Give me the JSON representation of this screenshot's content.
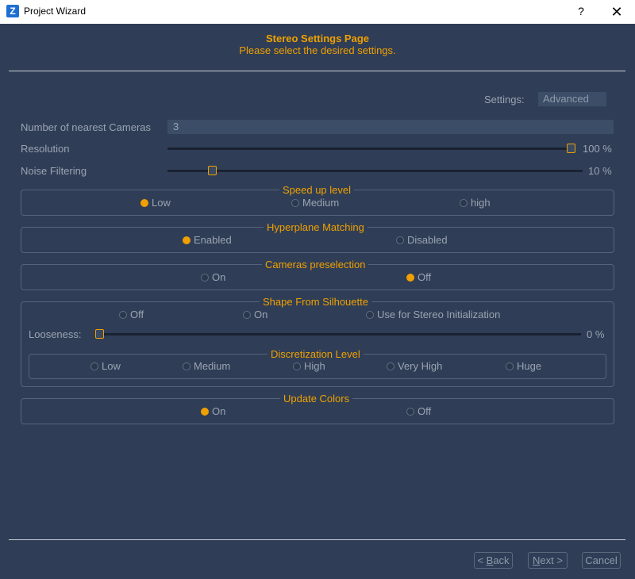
{
  "window": {
    "title": "Project Wizard",
    "help": "?",
    "close": "✕",
    "icon_letter": "Z"
  },
  "page": {
    "title": "Stereo Settings Page",
    "subtitle": "Please select the desired settings."
  },
  "settings": {
    "label": "Settings:",
    "value": "Advanced"
  },
  "cameras": {
    "label": "Number of nearest Cameras",
    "value": "3"
  },
  "resolution": {
    "label": "Resolution",
    "value_text": "100 %",
    "level_percent": 100
  },
  "noise": {
    "label": "Noise Filtering",
    "value_text": "10 %",
    "level_percent": 10
  },
  "speed": {
    "title": "Speed up level",
    "options": [
      "Low",
      "Medium",
      "high"
    ],
    "selected": "Low"
  },
  "hyperplane": {
    "title": "Hyperplane Matching",
    "options": [
      "Enabled",
      "Disabled"
    ],
    "selected": "Enabled"
  },
  "preselection": {
    "title": "Cameras preselection",
    "options": [
      "On",
      "Off"
    ],
    "selected": "Off"
  },
  "silhouette": {
    "title": "Shape From Silhouette",
    "options": [
      "Off",
      "On",
      "Use for Stereo Initialization"
    ],
    "selected": null,
    "looseness_label": "Looseness:",
    "looseness_text": "0 %",
    "looseness_percent": 0,
    "discretization": {
      "title": "Discretization Level",
      "options": [
        "Low",
        "Medium",
        "High",
        "Very High",
        "Huge"
      ],
      "selected": null
    }
  },
  "update_colors": {
    "title": "Update Colors",
    "options": [
      "On",
      "Off"
    ],
    "selected": "On"
  },
  "buttons": {
    "back": {
      "prefix": "< ",
      "accel": "B",
      "rest": "ack"
    },
    "next": {
      "accel": "N",
      "rest": "ext >"
    },
    "cancel": "Cancel"
  },
  "colors": {
    "accent": "#f0a000",
    "background": "#2f3e56",
    "field": "#3c4d67"
  }
}
